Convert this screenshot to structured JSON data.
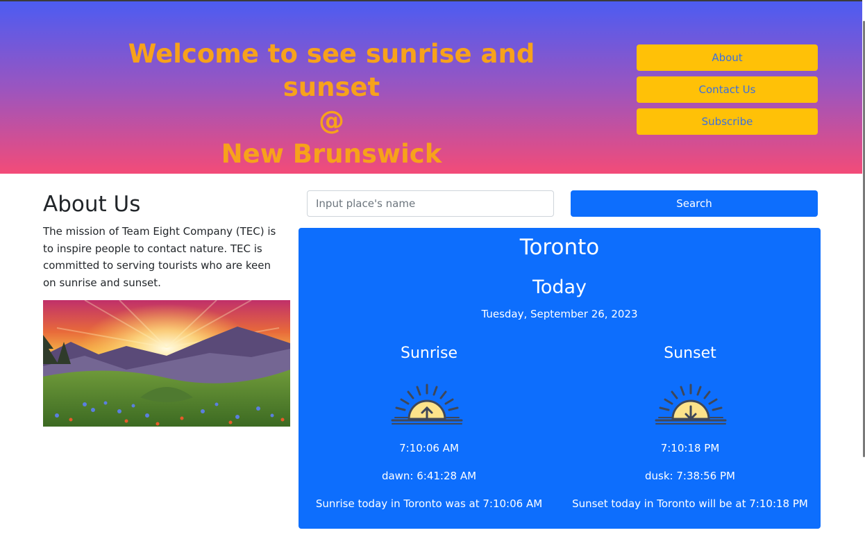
{
  "header": {
    "title_line1": "Welcome to see sunrise and sunset",
    "title_line2": "@",
    "title_line3": "New Brunswick",
    "nav": [
      {
        "label": "About"
      },
      {
        "label": "Contact Us"
      },
      {
        "label": "Subscribe"
      }
    ]
  },
  "about": {
    "title": "About Us",
    "text": "The mission of Team Eight Company (TEC) is to inspire people to contact nature. TEC is committed to serving tourists who are keen on sunrise and sunset."
  },
  "search": {
    "placeholder": "Input place's name",
    "button_label": "Search"
  },
  "result": {
    "city": "Toronto",
    "day_label": "Today",
    "date": "Tuesday, September 26, 2023",
    "sunrise": {
      "title": "Sunrise",
      "icon": "sunrise-icon",
      "time": "7:10:06 AM",
      "twilight": "dawn: 6:41:28 AM",
      "summary": "Sunrise today in Toronto was at 7:10:06 AM"
    },
    "sunset": {
      "title": "Sunset",
      "icon": "sunset-icon",
      "time": "7:10:18 PM",
      "twilight": "dusk: 7:38:56 PM",
      "summary": "Sunset today in Toronto will be at 7:10:18 PM"
    }
  },
  "colors": {
    "hero_top": "#4c5cf2",
    "hero_bottom": "#f34b78",
    "title_orange": "#f7a21b",
    "nav_yellow": "#ffc107",
    "primary_blue": "#0d6efd"
  }
}
